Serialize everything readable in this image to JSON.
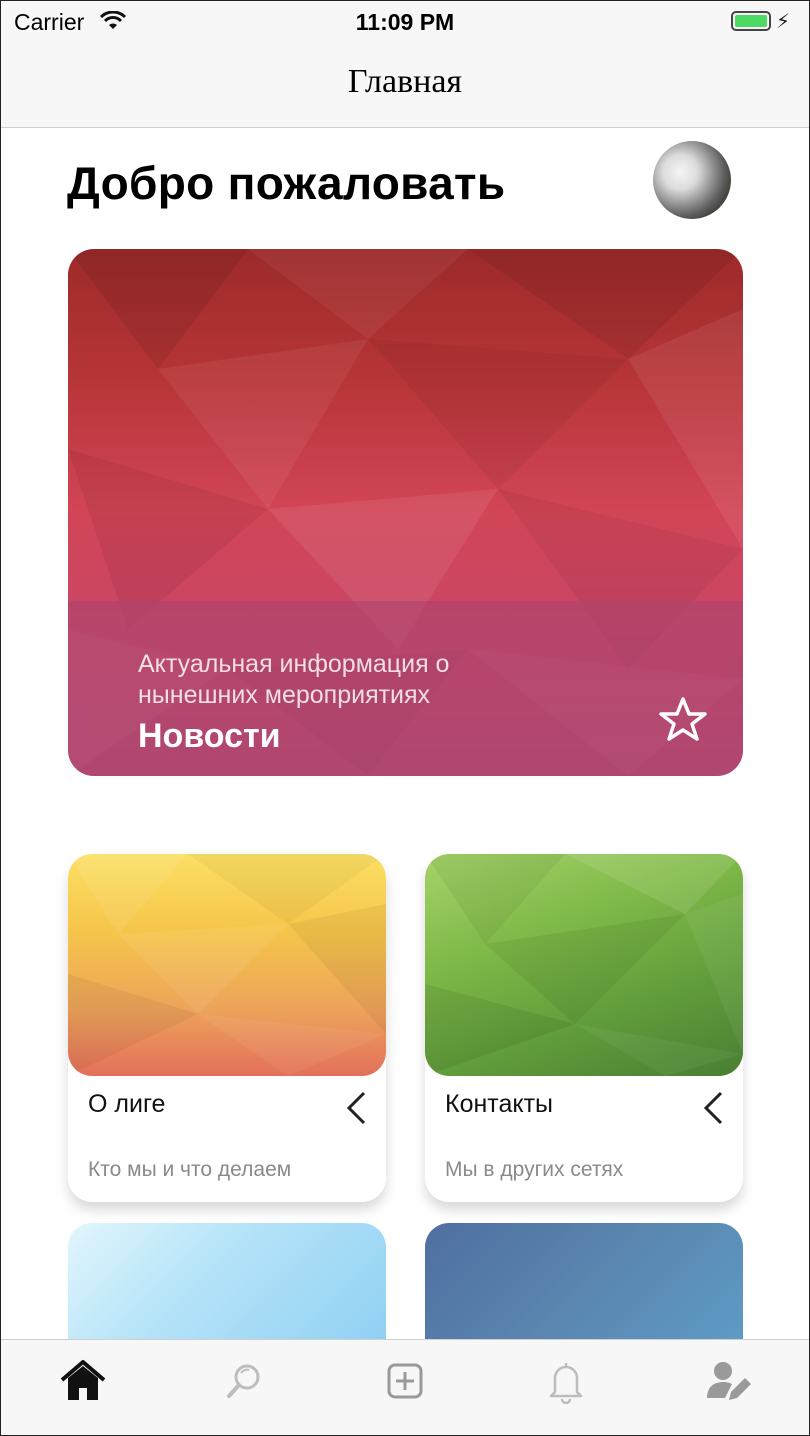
{
  "status_bar": {
    "carrier": "Carrier",
    "time": "11:09 PM"
  },
  "nav": {
    "title": "Главная"
  },
  "welcome": "Добро пожаловать",
  "hero": {
    "subtitle": "Актуальная информация о нынешних мероприятиях",
    "title": "Новости"
  },
  "cards": [
    {
      "title": "О лиге",
      "subtitle": "Кто мы и что делаем"
    },
    {
      "title": "Контакты",
      "subtitle": "Мы в других сетях"
    }
  ],
  "colors": {
    "accent_green": "#4cd964",
    "hero_red": "#d24556",
    "card_yellow": "#f5c54a",
    "card_green": "#6aa63a",
    "card_light_blue": "#a8dcf5",
    "card_dark_blue": "#5a86b0"
  },
  "tabs": [
    {
      "icon": "home-icon",
      "active": true
    },
    {
      "icon": "search-icon",
      "active": false
    },
    {
      "icon": "add-icon",
      "active": false
    },
    {
      "icon": "bell-icon",
      "active": false
    },
    {
      "icon": "user-edit-icon",
      "active": false
    }
  ]
}
